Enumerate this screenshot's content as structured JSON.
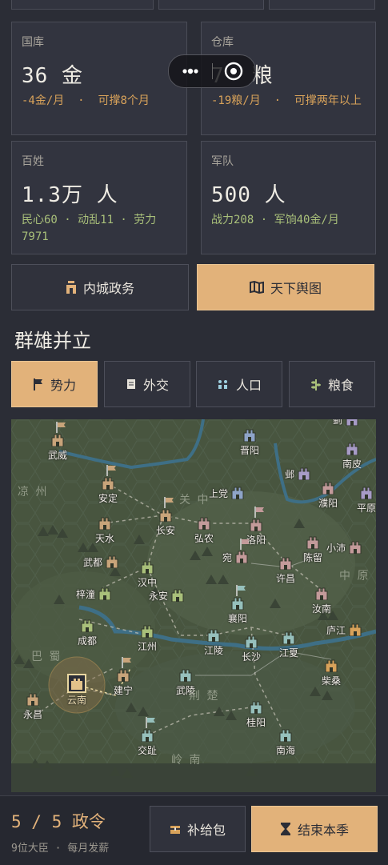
{
  "treasury": {
    "label": "国库",
    "value": "36 金",
    "sub_a": "-4金/月",
    "sub_dot": "·",
    "sub_b": "可撑8个月"
  },
  "granary": {
    "label": "仓库",
    "value": "7",
    "value_rest": "粮",
    "sub_a": "-19粮/月",
    "sub_dot": "·",
    "sub_b": "可撑两年以上"
  },
  "people": {
    "label": "百姓",
    "value": "1.3万 人",
    "sub": "民心60 · 动乱11 · 劳力7971"
  },
  "army": {
    "label": "军队",
    "value": "500 人",
    "sub": "战力208 · 军饷40金/月"
  },
  "buttons": {
    "inner": "内城政务",
    "world": "天下舆图"
  },
  "section_title": "群雄并立",
  "tabs": [
    {
      "label": "势力",
      "icon": "flag-icon"
    },
    {
      "label": "外交",
      "icon": "scroll-icon"
    },
    {
      "label": "人口",
      "icon": "people-icon"
    },
    {
      "label": "粮食",
      "icon": "grain-icon"
    }
  ],
  "map": {
    "regions": [
      "凉州",
      "关中",
      "中原",
      "巴蜀",
      "荆楚",
      "岭南"
    ],
    "cities": [
      {
        "name": "武威",
        "faction": "tan"
      },
      {
        "name": "晋阳",
        "faction": "blue"
      },
      {
        "name": "南皮",
        "faction": "purple"
      },
      {
        "name": "安定",
        "faction": "tan"
      },
      {
        "name": "上党",
        "faction": "blue"
      },
      {
        "name": "邺",
        "faction": "purple"
      },
      {
        "name": "濮阳",
        "faction": "pink"
      },
      {
        "name": "平原",
        "faction": "purple"
      },
      {
        "name": "天水",
        "faction": "tan"
      },
      {
        "name": "长安",
        "faction": "tan"
      },
      {
        "name": "弘农",
        "faction": "pink"
      },
      {
        "name": "洛阳",
        "faction": "pink"
      },
      {
        "name": "陈留",
        "faction": "pink"
      },
      {
        "name": "小沛",
        "faction": "pink"
      },
      {
        "name": "武都",
        "faction": "tan"
      },
      {
        "name": "汉中",
        "faction": "green"
      },
      {
        "name": "宛",
        "faction": "pink"
      },
      {
        "name": "许昌",
        "faction": "pink"
      },
      {
        "name": "梓潼",
        "faction": "green"
      },
      {
        "name": "永安",
        "faction": "green"
      },
      {
        "name": "襄阳",
        "faction": "cyan"
      },
      {
        "name": "汝南",
        "faction": "pink"
      },
      {
        "name": "成都",
        "faction": "green"
      },
      {
        "name": "江州",
        "faction": "green"
      },
      {
        "name": "江陵",
        "faction": "cyan"
      },
      {
        "name": "长沙",
        "faction": "cyan"
      },
      {
        "name": "江夏",
        "faction": "cyan"
      },
      {
        "name": "庐江",
        "faction": "orange"
      },
      {
        "name": "柴桑",
        "faction": "orange"
      },
      {
        "name": "建宁",
        "faction": "tan"
      },
      {
        "name": "云南",
        "faction": "player"
      },
      {
        "name": "武陵",
        "faction": "cyan"
      },
      {
        "name": "永昌",
        "faction": "tan"
      },
      {
        "name": "桂阳",
        "faction": "cyan"
      },
      {
        "name": "交趾",
        "faction": "cyan"
      },
      {
        "name": "南海",
        "faction": "cyan"
      },
      {
        "name": "蓟",
        "faction": "purple"
      }
    ]
  },
  "footer": {
    "orders": "5 / 5 政令",
    "info": "9位大臣 · 每月发薪",
    "supply_button": "补给包",
    "end_button": "结束本季"
  },
  "colors": {
    "accent": "#e2b27a",
    "gold": "#d8a25a",
    "green": "#a9c07a"
  }
}
